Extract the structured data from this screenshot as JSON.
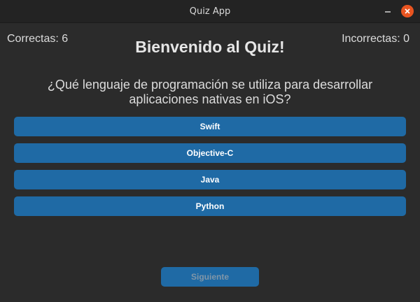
{
  "window": {
    "title": "Quiz App"
  },
  "score": {
    "correct_label": "Correctas: 6",
    "incorrect_label": "Incorrectas: 0"
  },
  "heading": "Bienvenido al Quiz!",
  "question": "¿Qué lenguaje de programación se utiliza para desarrollar aplicaciones nativas en iOS?",
  "options": [
    {
      "label": "Swift"
    },
    {
      "label": "Objective-C"
    },
    {
      "label": "Java"
    },
    {
      "label": "Python"
    }
  ],
  "next_button": {
    "label": "Siguiente",
    "state": "disabled"
  },
  "colors": {
    "background": "#2b2b2b",
    "titlebar": "#232323",
    "button": "#1f6aa5",
    "close_button": "#e95420"
  },
  "icons": {
    "minimize": "minimize-icon",
    "close": "close-icon"
  }
}
